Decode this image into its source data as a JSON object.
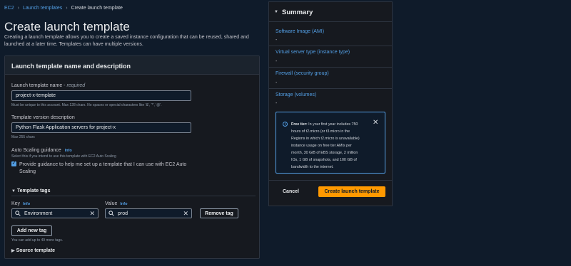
{
  "breadcrumb": {
    "items": [
      "EC2",
      "Launch templates",
      "Create launch template"
    ]
  },
  "page": {
    "title": "Create launch template",
    "description": "Creating a launch template allows you to create a saved instance configuration that can be reused, shared and launched at a later time. Templates can have multiple versions."
  },
  "panel": {
    "title": "Launch template name and description",
    "name_label": "Launch template name -",
    "name_required": "required",
    "name_value": "project-x-template",
    "name_hint": "Must be unique to this account. Max 128 chars. No spaces or special characters like '&', '*', '@'.",
    "version_label": "Template version description",
    "version_value": "Python Flask Application servers for project-x",
    "version_hint": "Max 255 chars",
    "asg_label": "Auto Scaling guidance",
    "info": "Info",
    "asg_hint": "Select this if you intend to use this template with EC2 Auto Scaling",
    "asg_checkbox_label_1": "Provide guidance to help me set up a template that I can use with EC2 Auto",
    "asg_checkbox_label_2": "Scaling",
    "asg_checked": true
  },
  "tags": {
    "section_title": "Template tags",
    "key_label": "Key",
    "value_label": "Value",
    "key_value": "Environment",
    "value_value": "prod",
    "remove_button": "Remove tag",
    "add_button": "Add new tag",
    "hint": "You can add up to 49 more tags."
  },
  "source": {
    "section_title": "Source template"
  },
  "summary": {
    "title": "Summary",
    "items": [
      {
        "label": "Software Image (AMI)",
        "value": "-"
      },
      {
        "label": "Virtual server type (instance type)",
        "value": "-"
      },
      {
        "label": "Firewall (security group)",
        "value": "-"
      },
      {
        "label": "Storage (volumes)",
        "value": "-"
      }
    ],
    "free_tier_title": "Free tier:",
    "free_tier_lines": [
      "In your first year includes 750",
      "hours of t2.micro (or t3.micro in the",
      "Regions in which t2.micro is unavailable)",
      "instance usage on free tier AMIs per",
      "month, 30 GiB of EBS storage, 2 million",
      "IOs, 1 GB of snapshots, and 100 GB of",
      "bandwidth to the internet."
    ],
    "cancel": "Cancel",
    "create": "Create launch template"
  },
  "colors": {
    "accent": "#539fe5",
    "primary": "#ff9900",
    "background": "#0f1b2a"
  }
}
